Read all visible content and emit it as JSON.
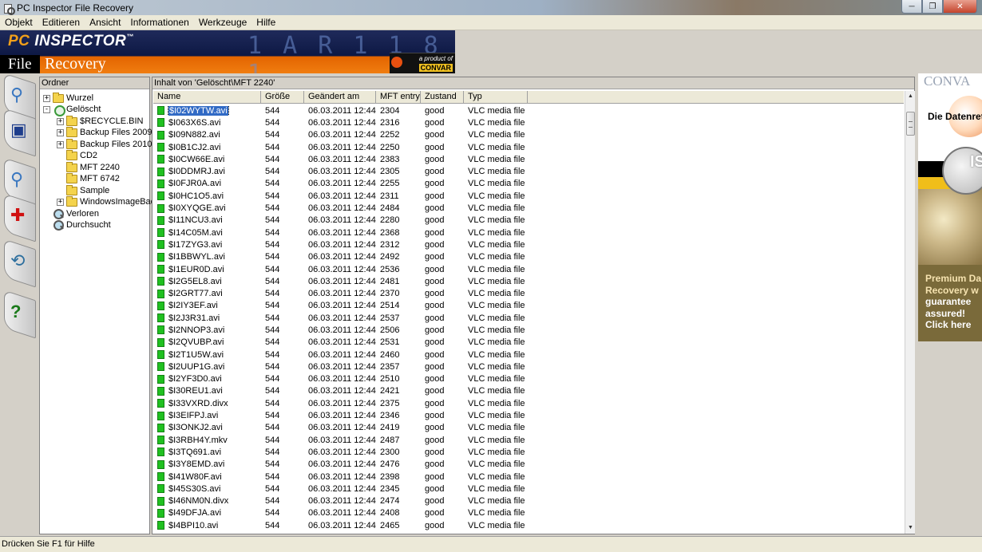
{
  "window": {
    "title": "PC Inspector File Recovery"
  },
  "menu": [
    "Objekt",
    "Editieren",
    "Ansicht",
    "Informationen",
    "Werkzeuge",
    "Hilfe"
  ],
  "banner": {
    "pc": "PC",
    "inspector": "INSPECTOR",
    "tm": "™",
    "file": "File",
    "recovery": "Recovery",
    "product_line": "a product of",
    "brand": "CONVAR"
  },
  "tree": {
    "header": "Ordner",
    "nodes": [
      {
        "label": "Wurzel",
        "level": 0,
        "expander": "+",
        "icon": "folder-icon"
      },
      {
        "label": "Gelöscht",
        "level": 0,
        "expander": "-",
        "icon": "recycle-icon"
      },
      {
        "label": "$RECYCLE.BIN",
        "level": 1,
        "expander": "+",
        "icon": "folder-icon"
      },
      {
        "label": "Backup Files 2009-",
        "level": 1,
        "expander": "+",
        "icon": "folder-icon"
      },
      {
        "label": "Backup Files 2010-",
        "level": 1,
        "expander": "+",
        "icon": "folder-icon"
      },
      {
        "label": "CD2",
        "level": 1,
        "expander": "",
        "icon": "folder-icon"
      },
      {
        "label": "MFT 2240",
        "level": 1,
        "expander": "",
        "icon": "folder-icon"
      },
      {
        "label": "MFT 6742",
        "level": 1,
        "expander": "",
        "icon": "folder-icon"
      },
      {
        "label": "Sample",
        "level": 1,
        "expander": "",
        "icon": "folder-icon"
      },
      {
        "label": "WindowsImageBac",
        "level": 1,
        "expander": "+",
        "icon": "folder-icon"
      },
      {
        "label": "Verloren",
        "level": 0,
        "expander": "",
        "icon": "lost-icon"
      },
      {
        "label": "Durchsucht",
        "level": 0,
        "expander": "",
        "icon": "search-doc-icon"
      }
    ]
  },
  "list": {
    "caption": "Inhalt von 'Gelöscht\\MFT 2240'",
    "columns": [
      "Name",
      "Größe",
      "Geändert am",
      "MFT entry",
      "Zustand",
      "Typ"
    ],
    "rows": [
      [
        "$I02WYTW.avi",
        "544",
        "06.03.2011 12:44",
        "2304",
        "good",
        "VLC media file (...."
      ],
      [
        "$I063X6S.avi",
        "544",
        "06.03.2011 12:44",
        "2316",
        "good",
        "VLC media file (...."
      ],
      [
        "$I09N882.avi",
        "544",
        "06.03.2011 12:44",
        "2252",
        "good",
        "VLC media file (...."
      ],
      [
        "$I0B1CJ2.avi",
        "544",
        "06.03.2011 12:44",
        "2250",
        "good",
        "VLC media file (...."
      ],
      [
        "$I0CW66E.avi",
        "544",
        "06.03.2011 12:44",
        "2383",
        "good",
        "VLC media file (...."
      ],
      [
        "$I0DDMRJ.avi",
        "544",
        "06.03.2011 12:44",
        "2305",
        "good",
        "VLC media file (...."
      ],
      [
        "$I0FJR0A.avi",
        "544",
        "06.03.2011 12:44",
        "2255",
        "good",
        "VLC media file (...."
      ],
      [
        "$I0HC1O5.avi",
        "544",
        "06.03.2011 12:44",
        "2311",
        "good",
        "VLC media file (...."
      ],
      [
        "$I0XYQGE.avi",
        "544",
        "06.03.2011 12:44",
        "2484",
        "good",
        "VLC media file (...."
      ],
      [
        "$I11NCU3.avi",
        "544",
        "06.03.2011 12:44",
        "2280",
        "good",
        "VLC media file (...."
      ],
      [
        "$I14C05M.avi",
        "544",
        "06.03.2011 12:44",
        "2368",
        "good",
        "VLC media file (...."
      ],
      [
        "$I17ZYG3.avi",
        "544",
        "06.03.2011 12:44",
        "2312",
        "good",
        "VLC media file (...."
      ],
      [
        "$I1BBWYL.avi",
        "544",
        "06.03.2011 12:44",
        "2492",
        "good",
        "VLC media file (...."
      ],
      [
        "$I1EUR0D.avi",
        "544",
        "06.03.2011 12:44",
        "2536",
        "good",
        "VLC media file (...."
      ],
      [
        "$I2G5EL8.avi",
        "544",
        "06.03.2011 12:44",
        "2481",
        "good",
        "VLC media file (...."
      ],
      [
        "$I2GRT77.avi",
        "544",
        "06.03.2011 12:44",
        "2370",
        "good",
        "VLC media file (...."
      ],
      [
        "$I2IY3EF.avi",
        "544",
        "06.03.2011 12:44",
        "2514",
        "good",
        "VLC media file (...."
      ],
      [
        "$I2J3R31.avi",
        "544",
        "06.03.2011 12:44",
        "2537",
        "good",
        "VLC media file (...."
      ],
      [
        "$I2NNOP3.avi",
        "544",
        "06.03.2011 12:44",
        "2506",
        "good",
        "VLC media file (...."
      ],
      [
        "$I2QVUBP.avi",
        "544",
        "06.03.2011 12:44",
        "2531",
        "good",
        "VLC media file (...."
      ],
      [
        "$I2T1U5W.avi",
        "544",
        "06.03.2011 12:44",
        "2460",
        "good",
        "VLC media file (...."
      ],
      [
        "$I2UUP1G.avi",
        "544",
        "06.03.2011 12:44",
        "2357",
        "good",
        "VLC media file (...."
      ],
      [
        "$I2YF3D0.avi",
        "544",
        "06.03.2011 12:44",
        "2510",
        "good",
        "VLC media file (...."
      ],
      [
        "$I30REU1.avi",
        "544",
        "06.03.2011 12:44",
        "2421",
        "good",
        "VLC media file (...."
      ],
      [
        "$I33VXRD.divx",
        "544",
        "06.03.2011 12:44",
        "2375",
        "good",
        "VLC media file (...."
      ],
      [
        "$I3EIFPJ.avi",
        "544",
        "06.03.2011 12:44",
        "2346",
        "good",
        "VLC media file (...."
      ],
      [
        "$I3ONKJ2.avi",
        "544",
        "06.03.2011 12:44",
        "2419",
        "good",
        "VLC media file (...."
      ],
      [
        "$I3RBH4Y.mkv",
        "544",
        "06.03.2011 12:44",
        "2487",
        "good",
        "VLC media file (...."
      ],
      [
        "$I3TQ691.avi",
        "544",
        "06.03.2011 12:44",
        "2300",
        "good",
        "VLC media file (...."
      ],
      [
        "$I3Y8EMD.avi",
        "544",
        "06.03.2011 12:44",
        "2476",
        "good",
        "VLC media file (...."
      ],
      [
        "$I41W80F.avi",
        "544",
        "06.03.2011 12:44",
        "2398",
        "good",
        "VLC media file (...."
      ],
      [
        "$I45S30S.avi",
        "544",
        "06.03.2011 12:44",
        "2345",
        "good",
        "VLC media file (...."
      ],
      [
        "$I46NM0N.divx",
        "544",
        "06.03.2011 12:44",
        "2474",
        "good",
        "VLC media file (...."
      ],
      [
        "$I49DFJA.avi",
        "544",
        "06.03.2011 12:44",
        "2408",
        "good",
        "VLC media file (...."
      ],
      [
        "$I4BPI10.avi",
        "544",
        "06.03.2011 12:44",
        "2465",
        "good",
        "VLC media file (...."
      ]
    ]
  },
  "ad": {
    "brand": "CONVA",
    "tagline": "Die Datenret",
    "iso": "IS",
    "lines": [
      "Premium Da",
      "Recovery w",
      "guarantee",
      "assured!",
      "Click here"
    ]
  },
  "status": {
    "text": "Drücken Sie F1 für Hilfe"
  },
  "colors": {
    "banner_orange": "#f07d10",
    "banner_navy": "#0d1844",
    "file_icon": "#20c020",
    "selection": "#316ac5"
  }
}
